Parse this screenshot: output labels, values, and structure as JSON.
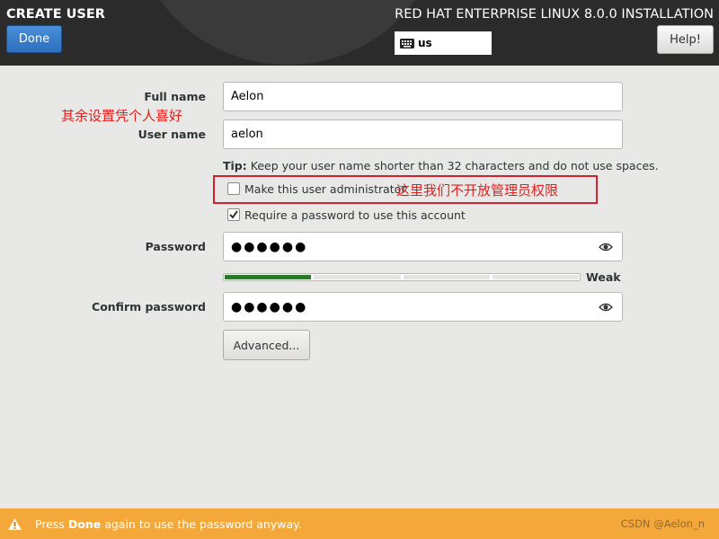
{
  "header": {
    "spoke_title": "CREATE USER",
    "done_label": "Done",
    "product_title": "RED HAT ENTERPRISE LINUX 8.0.0 INSTALLATION",
    "keyboard_layout": "us",
    "help_label": "Help!"
  },
  "form": {
    "full_name_label": "Full name",
    "full_name_value": "Aelon",
    "user_name_label": "User name",
    "user_name_value": "aelon",
    "tip_prefix": "Tip:",
    "tip_text": " Keep your user name shorter than 32 characters and do not use spaces.",
    "admin_label": "Make this user administrator",
    "admin_checked": false,
    "require_password_label": "Require a password to use this account",
    "require_password_checked": true,
    "password_label": "Password",
    "password_value": "●●●●●●",
    "strength_label": "Weak",
    "strength_fraction": 0.25,
    "confirm_label": "Confirm password",
    "confirm_value": "●●●●●●",
    "advanced_label": "Advanced..."
  },
  "annotations": {
    "left_note": "其余设置凭个人喜好",
    "admin_note": "这里我们不开放管理员权限"
  },
  "warning": {
    "text_before": "Press ",
    "text_bold": "Done",
    "text_after": " again to use the password anyway."
  },
  "watermark": "CSDN @Aelon_n",
  "colors": {
    "accent_blue": "#3b7fd0",
    "warning_orange": "#f5a83a",
    "annotation_red": "#e0201e",
    "strength_green": "#2a7a2a"
  }
}
